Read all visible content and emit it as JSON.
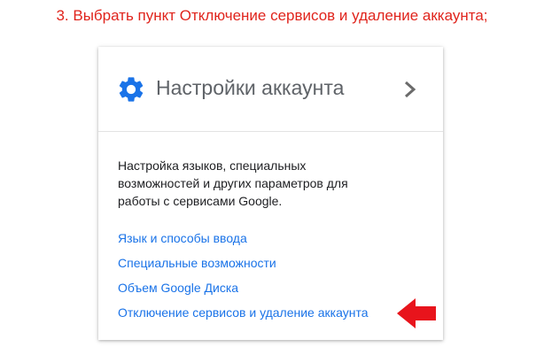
{
  "instruction": {
    "text": "3. Выбрать пункт Отключение сервисов и удаление аккаунта;"
  },
  "card": {
    "icon": "gear-icon",
    "title": "Настройки аккаунта",
    "chevron_icon": "chevron-right-icon",
    "description": "Настройка языков, специальных возможностей и других параметров для работы с сервисами Google.",
    "links": [
      {
        "label": "Язык и способы ввода"
      },
      {
        "label": "Специальные возможности"
      },
      {
        "label": "Объем Google Диска"
      },
      {
        "label": "Отключение сервисов и удаление аккаунта"
      }
    ]
  },
  "annotation": {
    "icon": "red-arrow-left-icon"
  },
  "colors": {
    "caption": "#e0241c",
    "accent_blue": "#1a73e8",
    "title_gray": "#5f6368",
    "arrow_red": "#e8141c"
  }
}
